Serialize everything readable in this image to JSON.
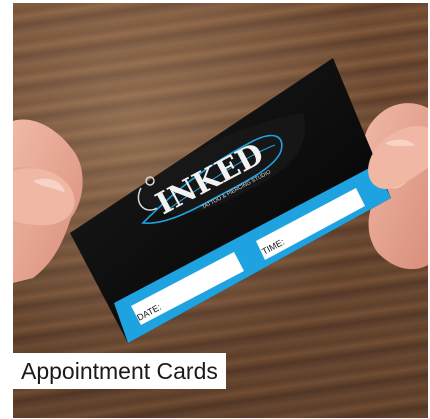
{
  "card": {
    "brand": "INKED",
    "tagline": "TATTOO & PIERCING STUDIO",
    "date_label": "DATE:",
    "time_label": "TIME:"
  },
  "caption": "Appointment Cards",
  "colors": {
    "card_black": "#0d0d0d",
    "accent_blue": "#1fa3e0",
    "field_white": "#ffffff"
  }
}
